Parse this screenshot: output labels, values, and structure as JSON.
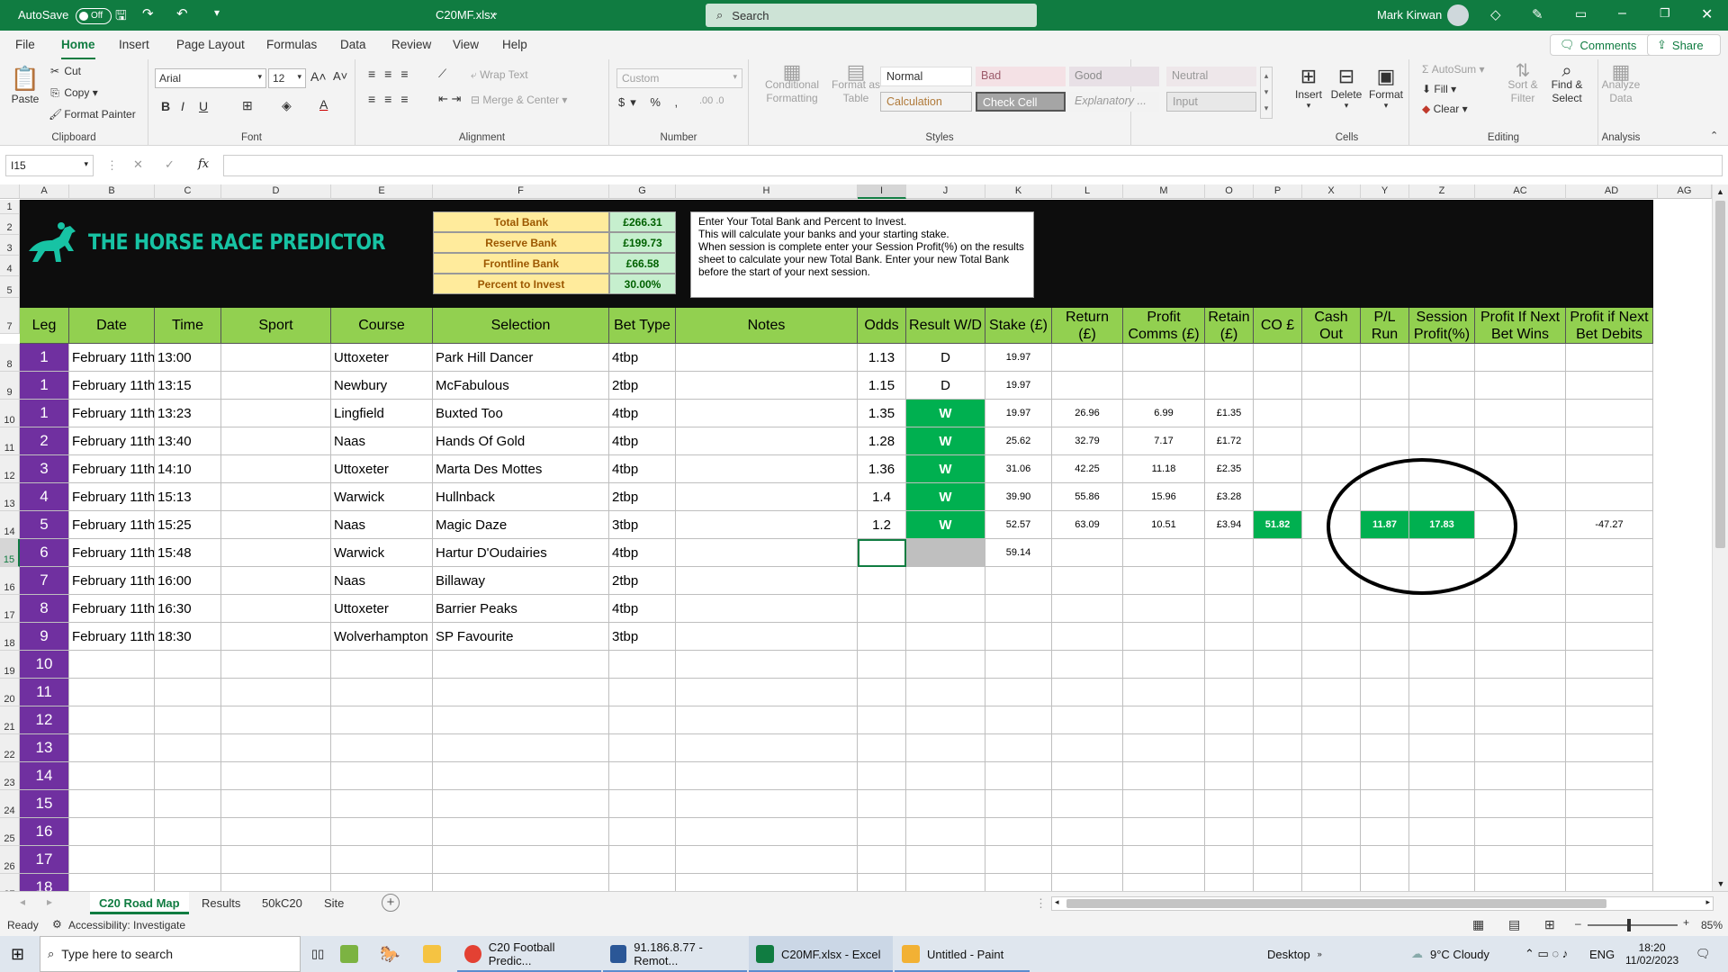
{
  "titlebar": {
    "autosave_label": "AutoSave",
    "autosave_state": "Off",
    "filename": "C20MF.xlsx",
    "search_placeholder": "Search",
    "user_name": "Mark Kirwan"
  },
  "menu": {
    "items": [
      "File",
      "Home",
      "Insert",
      "Page Layout",
      "Formulas",
      "Data",
      "Review",
      "View",
      "Help"
    ],
    "active": "Home",
    "comments": "Comments",
    "share": "Share"
  },
  "ribbon": {
    "clipboard": {
      "paste": "Paste",
      "cut": "Cut",
      "copy": "Copy",
      "format_painter": "Format Painter",
      "label": "Clipboard"
    },
    "font": {
      "name": "Arial",
      "size": "12",
      "label": "Font"
    },
    "alignment": {
      "wrap_text": "Wrap Text",
      "merge": "Merge & Center",
      "label": "Alignment"
    },
    "number": {
      "format": "Custom",
      "label": "Number"
    },
    "styles": {
      "conditional": "Conditional Formatting",
      "format_table": "Format as Table",
      "normal": "Normal",
      "bad": "Bad",
      "good": "Good",
      "neutral": "Neutral",
      "calculation": "Calculation",
      "check_cell": "Check Cell",
      "explanatory": "Explanatory ...",
      "input": "Input",
      "label": "Styles"
    },
    "cells": {
      "insert": "Insert",
      "delete": "Delete",
      "format": "Format",
      "label": "Cells"
    },
    "editing": {
      "autosum": "AutoSum",
      "fill": "Fill",
      "clear": "Clear",
      "sort": "Sort & Filter",
      "find": "Find & Select",
      "label": "Editing"
    },
    "analysis": {
      "analyze": "Analyze Data",
      "label": "Analysis"
    }
  },
  "formula_bar": {
    "name_box": "I15",
    "fx": "fx",
    "content": ""
  },
  "columns": [
    "A",
    "B",
    "C",
    "D",
    "E",
    "F",
    "G",
    "H",
    "I",
    "J",
    "K",
    "L",
    "M",
    "O",
    "P",
    "X",
    "Y",
    "Z",
    "AC",
    "AD",
    "AG"
  ],
  "rows": [
    "1",
    "2",
    "3",
    "4",
    "5",
    "7",
    "8",
    "9",
    "10",
    "11",
    "12",
    "13",
    "14",
    "15",
    "16",
    "17",
    "18",
    "19",
    "20",
    "21",
    "22",
    "23",
    "24",
    "25",
    "26",
    "27"
  ],
  "logo": {
    "text": "THE HORSE RACE PREDICTOR"
  },
  "bank": {
    "items": [
      {
        "label": "Total Bank",
        "value": "£266.31"
      },
      {
        "label": "Reserve Bank",
        "value": "£199.73"
      },
      {
        "label": "Frontline Bank",
        "value": "£66.58"
      },
      {
        "label": "Percent to Invest",
        "value": "30.00%"
      }
    ]
  },
  "instructions": "Enter Your Total Bank and Percent to Invest.\nThis will calculate your banks and your starting stake.\nWhen session is complete enter your Session Profit(%) on the results sheet to calculate your new Total Bank. Enter your new Total Bank before the start of your next session.",
  "headers": [
    "Leg",
    "Date",
    "Time",
    "Sport",
    "Course",
    "Selection",
    "Bet Type",
    "Notes",
    "Odds",
    "Result W/D",
    "Stake (£)",
    "Return (£)",
    "Profit Comms (£)",
    "Retain (£)",
    "CO £",
    "Cash Out",
    "P/L Run",
    "Session Profit(%)",
    "Profit If Next Bet Wins",
    "Profit if Next Bet Debits"
  ],
  "legs": [
    {
      "leg": "1",
      "date": "February 11th",
      "time": "13:00",
      "course": "Uttoxeter",
      "selection": "Park Hill Dancer",
      "bet": "4tbp",
      "odds": "1.13",
      "result": "D",
      "stake": "19.97"
    },
    {
      "leg": "1",
      "date": "February 11th",
      "time": "13:15",
      "course": "Newbury",
      "selection": "McFabulous",
      "bet": "2tbp",
      "odds": "1.15",
      "result": "D",
      "stake": "19.97"
    },
    {
      "leg": "1",
      "date": "February 11th",
      "time": "13:23",
      "course": "Lingfield",
      "selection": "Buxted Too",
      "bet": "4tbp",
      "odds": "1.35",
      "result": "W",
      "stake": "19.97",
      "ret": "26.96",
      "comms": "6.99",
      "retain": "£1.35"
    },
    {
      "leg": "2",
      "date": "February 11th",
      "time": "13:40",
      "course": "Naas",
      "selection": "Hands Of Gold",
      "bet": "4tbp",
      "odds": "1.28",
      "result": "W",
      "stake": "25.62",
      "ret": "32.79",
      "comms": "7.17",
      "retain": "£1.72"
    },
    {
      "leg": "3",
      "date": "February 11th",
      "time": "14:10",
      "course": "Uttoxeter",
      "selection": "Marta Des Mottes",
      "bet": "4tbp",
      "odds": "1.36",
      "result": "W",
      "stake": "31.06",
      "ret": "42.25",
      "comms": "11.18",
      "retain": "£2.35"
    },
    {
      "leg": "4",
      "date": "February 11th",
      "time": "15:13",
      "course": "Warwick",
      "selection": "Hullnback",
      "bet": "2tbp",
      "odds": "1.4",
      "result": "W",
      "stake": "39.90",
      "ret": "55.86",
      "comms": "15.96",
      "retain": "£3.28"
    },
    {
      "leg": "5",
      "date": "February 11th",
      "time": "15:25",
      "course": "Naas",
      "selection": "Magic Daze",
      "bet": "3tbp",
      "odds": "1.2",
      "result": "W",
      "stake": "52.57",
      "ret": "63.09",
      "comms": "10.51",
      "retain": "£3.94",
      "co": "51.82",
      "pl": "11.87",
      "session": "17.83",
      "debits": "-47.27"
    },
    {
      "leg": "6",
      "date": "February 11th",
      "time": "15:48",
      "course": "Warwick",
      "selection": "Hartur D'Oudairies",
      "bet": "4tbp",
      "stake": "59.14"
    },
    {
      "leg": "7",
      "date": "February 11th",
      "time": "16:00",
      "course": "Naas",
      "selection": "Billaway",
      "bet": "2tbp"
    },
    {
      "leg": "8",
      "date": "February 11th",
      "time": "16:30",
      "course": "Uttoxeter",
      "selection": "Barrier Peaks",
      "bet": "4tbp"
    },
    {
      "leg": "9",
      "date": "February 11th",
      "time": "18:30",
      "course": "Wolverhampton (",
      "selection": "SP Favourite",
      "bet": "3tbp"
    },
    {
      "leg": "10"
    },
    {
      "leg": "11"
    },
    {
      "leg": "12"
    },
    {
      "leg": "13"
    },
    {
      "leg": "14"
    },
    {
      "leg": "15"
    },
    {
      "leg": "16"
    },
    {
      "leg": "17"
    },
    {
      "leg": "18"
    }
  ],
  "sheet_tabs": [
    "C20 Road Map",
    "Results",
    "50kC20",
    "Site"
  ],
  "active_tab": "C20 Road Map",
  "status": {
    "ready": "Ready",
    "accessibility": "Accessibility: Investigate",
    "zoom": "85%"
  },
  "taskbar": {
    "search_placeholder": "Type here to search",
    "apps": [
      {
        "label": "C20 Football Predic..."
      },
      {
        "label": "91.186.8.77 - Remot..."
      },
      {
        "label": "C20MF.xlsx - Excel"
      },
      {
        "label": "Untitled - Paint"
      }
    ],
    "desktop": "Desktop",
    "weather": "9°C  Cloudy",
    "lang": "ENG",
    "time": "18:20",
    "date": "11/02/2023"
  },
  "colors": {
    "excel_green": "#107c41",
    "header_green": "#92d050",
    "leg_purple": "#7030a0",
    "win_green": "#00b050",
    "bank_yellow": "#ffeb9c",
    "bank_value_green": "#c6efce"
  }
}
